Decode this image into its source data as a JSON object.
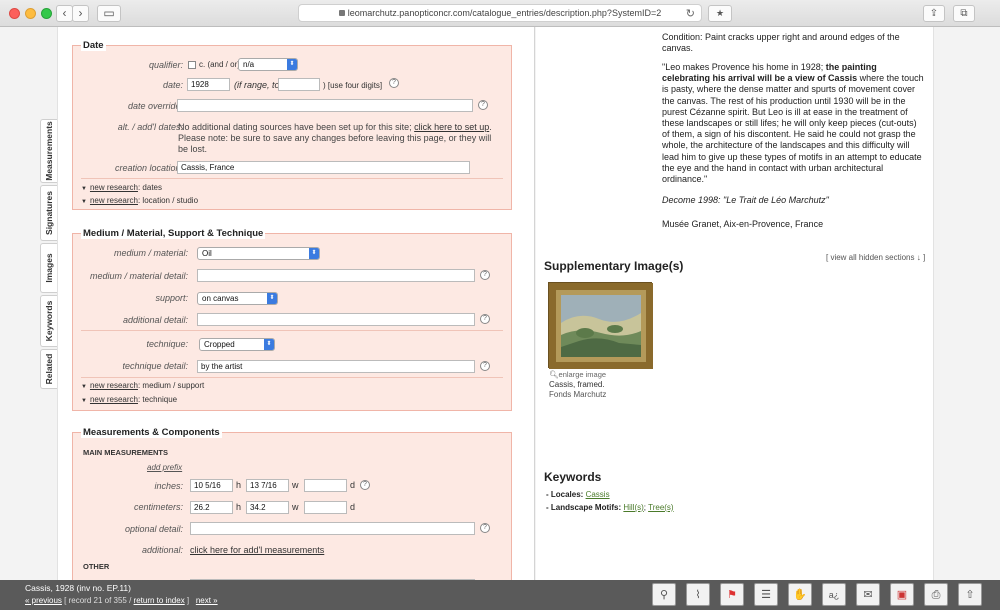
{
  "browser": {
    "url": "leomarchutz.panopticoncr.com/catalogue_entries/description.php?SystemID=2",
    "back": "‹",
    "forward": "›"
  },
  "tabs": [
    "Measurements",
    "Signatures",
    "Images",
    "Keywords",
    "Related"
  ],
  "date_section": {
    "legend": "Date",
    "qualifier_label": "qualifier:",
    "qualifier_c": "c. (and / or)",
    "qualifier_value": "n/a",
    "date_label": "date:",
    "date_value": "1928",
    "range_text": "(if range, to:",
    "four_digits": ") [use four digits]",
    "override_label": "date override:",
    "alt_label": "alt. / add'l dates:",
    "alt_text_1": "No additional dating sources have been set up for this site;",
    "alt_link": "click here to set up",
    "alt_text_2": ". Please note: be sure to save any changes before leaving this page, or they will be lost.",
    "creation_label": "creation location:",
    "creation_value": "Cassis, France",
    "nr1_link": "new research",
    "nr1_text": ": dates",
    "nr2_link": "new research",
    "nr2_text": ": location / studio"
  },
  "medium_section": {
    "legend": "Medium / Material, Support & Technique",
    "mm_label": "medium / material:",
    "mm_value": "Oil",
    "mmd_label": "medium / material detail:",
    "support_label": "support:",
    "support_value": "on canvas",
    "add_label": "additional detail:",
    "tech_label": "technique:",
    "tech_value": "Cropped",
    "techd_label": "technique detail:",
    "techd_value": "by the artist",
    "nr1_link": "new research",
    "nr1_text": ": medium / support",
    "nr2_link": "new research",
    "nr2_text": ": technique"
  },
  "meas_section": {
    "legend": "Measurements & Components",
    "main": "MAIN MEASUREMENTS",
    "add_prefix": "add prefix",
    "inches_label": "inches:",
    "in_h": "10 5/16",
    "in_w": "13 7/16",
    "cm_label": "centimeters:",
    "cm_h": "26.2",
    "cm_w": "34.2",
    "h": "h",
    "w": "w",
    "d": "d",
    "opt_label": "optional detail:",
    "addl_label": "additional:",
    "addl_link": "click here for add'l measurements",
    "other": "OTHER"
  },
  "right": {
    "condition": "Condition: Paint cracks upper right and around edges of the canvas.",
    "quote_1": "\"Leo makes Provence his home in 1928; ",
    "quote_bold": "the painting celebrating his arrival will be a view of Cassis",
    "quote_2": " where the touch is pasty, where the dense matter and spurts of movement cover the canvas. The rest of his production until 1930 will be in the purest Cézanne spirit. But Leo is ill at ease in the treatment of these landscapes or still lifes; he will only keep pieces (cut-outs) of them, a sign of his discontent. He said he could not grasp the whole, the architecture of the landscapes and this difficulty will lead him to give up these types of motifs in an attempt to educate the eye and the hand in contact with urban architectural ordinance.\"",
    "source": "Decome 1998: \"Le Trait de Léo Marchutz\"",
    "museum": "Musée Granet, Aix-en-Provence, France",
    "view_hidden": "[ view all hidden sections ↓ ]",
    "supp_title": "Supplementary Image(s)",
    "enlarge": "enlarge image",
    "caption_1": "Cassis, framed.",
    "caption_2": "Fonds Marchutz",
    "kw_title": "Keywords",
    "locales_label": "- Locales:",
    "locales_link": "Cassis",
    "motifs_label": "- Landscape Motifs:",
    "motif_1": "Hill(s)",
    "motif_sep": ";",
    "motif_2": "Tree(s)"
  },
  "footer": {
    "title": "Cassis, 1928 (inv no. EP.11)",
    "prev": "« previous",
    "record": "[ record 21 of 355 /",
    "return": "return to index",
    "close": "]",
    "next": "next »"
  }
}
